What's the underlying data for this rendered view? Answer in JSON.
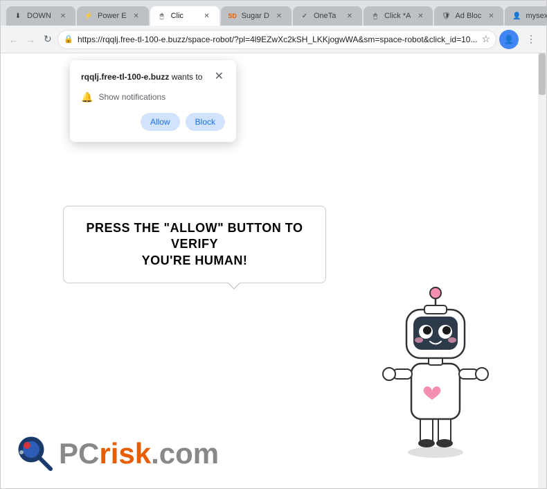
{
  "browser": {
    "tabs": [
      {
        "id": "tab1",
        "label": "DOWN",
        "favicon": "⬇",
        "active": false
      },
      {
        "id": "tab2",
        "label": "Power E",
        "favicon": "⚡",
        "active": false
      },
      {
        "id": "tab3",
        "label": "Clic",
        "favicon": "🖱",
        "active": true
      },
      {
        "id": "tab4",
        "label": "Sugar D",
        "favicon": "SD",
        "active": false
      },
      {
        "id": "tab5",
        "label": "OneTa",
        "favicon": "✓",
        "active": false
      },
      {
        "id": "tab6",
        "label": "Click *A",
        "favicon": "🖱",
        "active": false
      },
      {
        "id": "tab7",
        "label": "Ad Bloc",
        "favicon": "🛡",
        "active": false
      },
      {
        "id": "tab8",
        "label": "mysexy",
        "favicon": "👤",
        "active": false
      }
    ],
    "url": "https://rqqlj.free-tl-100-e.buzz/space-robot/?pl=4l9EZwXc2kSH_LKKjogwWA&sm=space-robot&click_id=10...",
    "window_controls": {
      "minimize": "—",
      "maximize": "□",
      "close": "✕"
    }
  },
  "notification": {
    "site": "rqqlj.free-tl-100-e.buzz",
    "wants_to": " wants to",
    "body_text": "Show notifications",
    "allow_label": "Allow",
    "block_label": "Block"
  },
  "page": {
    "speech_text_line1": "PRESS THE \"ALLOW\" BUTTON TO VERIFY",
    "speech_text_line2": "YOU'RE HUMAN!",
    "pcrisk_text": "risk.com",
    "pcrisk_pc": "PC"
  },
  "colors": {
    "allow_bg": "#d2e3fc",
    "block_bg": "#d2e3fc",
    "text_black": "#000000",
    "pcrisk_orange": "#e85d00",
    "pcrisk_gray": "#888888"
  }
}
